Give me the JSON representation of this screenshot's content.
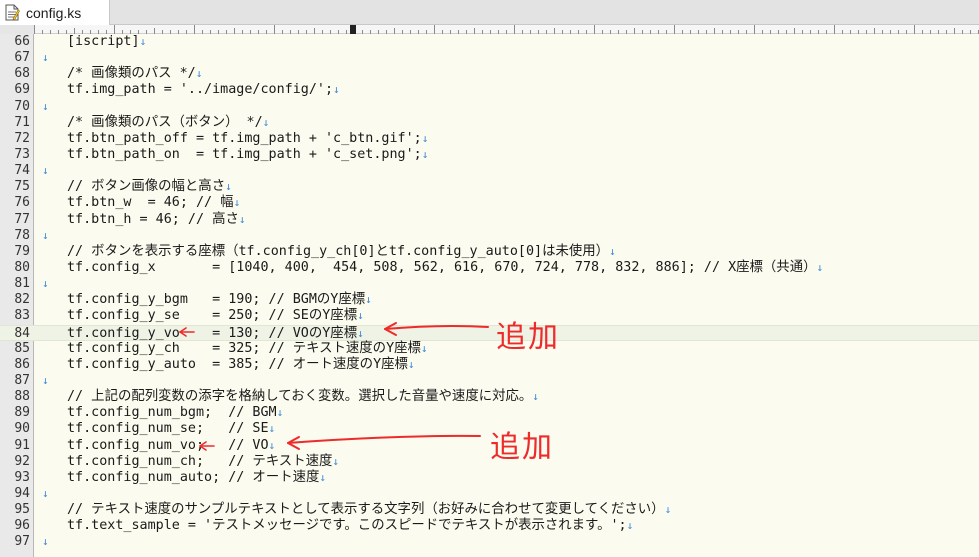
{
  "tab": {
    "file_name": "config.ks",
    "icon": "text-file-icon"
  },
  "editor": {
    "current_line": 84,
    "lines": [
      {
        "n": "66",
        "text": "[iscript]"
      },
      {
        "n": "67",
        "text": ""
      },
      {
        "n": "68",
        "text": "/* 画像類のパス */"
      },
      {
        "n": "69",
        "text": "tf.img_path = '../image/config/';"
      },
      {
        "n": "70",
        "text": ""
      },
      {
        "n": "71",
        "text": "/* 画像類のパス（ボタン） */"
      },
      {
        "n": "72",
        "text": "tf.btn_path_off = tf.img_path + 'c_btn.gif';"
      },
      {
        "n": "73",
        "text": "tf.btn_path_on  = tf.img_path + 'c_set.png';"
      },
      {
        "n": "74",
        "text": ""
      },
      {
        "n": "75",
        "text": "// ボタン画像の幅と高さ"
      },
      {
        "n": "76",
        "text": "tf.btn_w  = 46; // 幅"
      },
      {
        "n": "77",
        "text": "tf.btn_h = 46; // 高さ"
      },
      {
        "n": "78",
        "text": ""
      },
      {
        "n": "79",
        "text": "// ボタンを表示する座標（tf.config_y_ch[0]とtf.config_y_auto[0]は未使用）"
      },
      {
        "n": "80",
        "text": "tf.config_x       = [1040, 400,  454, 508, 562, 616, 670, 724, 778, 832, 886]; // X座標（共通）"
      },
      {
        "n": "81",
        "text": ""
      },
      {
        "n": "82",
        "text": "tf.config_y_bgm   = 190; // BGMのY座標"
      },
      {
        "n": "83",
        "text": "tf.config_y_se    = 250; // SEのY座標"
      },
      {
        "n": "84",
        "text": "tf.config_y_vo    = 130; // VOのY座標"
      },
      {
        "n": "85",
        "text": "tf.config_y_ch    = 325; // テキスト速度のY座標"
      },
      {
        "n": "86",
        "text": "tf.config_y_auto  = 385; // オート速度のY座標"
      },
      {
        "n": "87",
        "text": ""
      },
      {
        "n": "88",
        "text": "// 上記の配列変数の添字を格納しておく変数。選択した音量や速度に対応。"
      },
      {
        "n": "89",
        "text": "tf.config_num_bgm;  // BGM"
      },
      {
        "n": "90",
        "text": "tf.config_num_se;   // SE"
      },
      {
        "n": "91",
        "text": "tf.config_num_vo;   // VO"
      },
      {
        "n": "92",
        "text": "tf.config_num_ch;   // テキスト速度"
      },
      {
        "n": "93",
        "text": "tf.config_num_auto; // オート速度"
      },
      {
        "n": "94",
        "text": ""
      },
      {
        "n": "95",
        "text": "// テキスト速度のサンプルテキストとして表示する文字列（お好みに合わせて変更してください）"
      },
      {
        "n": "96",
        "text": "tf.text_sample = 'テストメッセージです。このスピードでテキストが表示されます。';"
      },
      {
        "n": "97",
        "text": ""
      }
    ]
  },
  "annotations": {
    "note_1": "追加",
    "note_2": "追加",
    "color": "#ee2a2a"
  },
  "colors": {
    "eol_mark": "#3d8ad6",
    "current_line": "#eef3e6",
    "background": "#fbfbef"
  }
}
